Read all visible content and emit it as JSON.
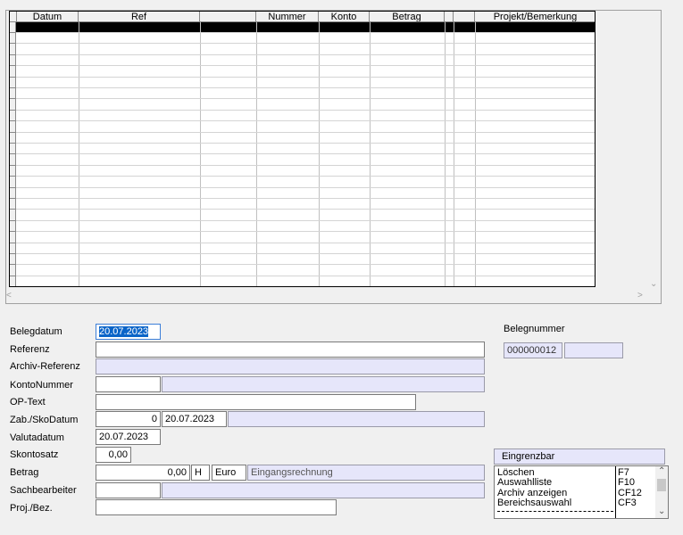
{
  "grid": {
    "columns": [
      "Datum",
      "Ref",
      "",
      "Nummer",
      "Konto",
      "Betrag",
      "",
      "",
      "Projekt/Bemerkung"
    ]
  },
  "form": {
    "belegdatum": {
      "label": "Belegdatum",
      "value": "20.07.2023"
    },
    "referenz": {
      "label": "Referenz",
      "value": ""
    },
    "archiv_referenz": {
      "label": "Archiv-Referenz",
      "value": ""
    },
    "kontonummer": {
      "label": "KontoNummer",
      "value": "",
      "name": ""
    },
    "op_text": {
      "label": "OP-Text",
      "value": ""
    },
    "zab_sko": {
      "label": "Zab./SkoDatum",
      "days": "0",
      "date": "20.07.2023",
      "extra": ""
    },
    "valutadatum": {
      "label": "Valutadatum",
      "value": "20.07.2023"
    },
    "skontosatz": {
      "label": "Skontosatz",
      "value": "0,00"
    },
    "betrag": {
      "label": "Betrag",
      "value": "0,00",
      "side": "H",
      "currency": "Euro",
      "type": "Eingangsrechnung"
    },
    "sachbearbeiter": {
      "label": "Sachbearbeiter",
      "code": "",
      "name": ""
    },
    "proj_bez": {
      "label": "Proj./Bez.",
      "value": ""
    }
  },
  "belegnummer": {
    "label": "Belegnummer",
    "value": "000000012",
    "suffix": ""
  },
  "eingrenzbar": {
    "label": "Eingrenzbar"
  },
  "shortcuts": [
    {
      "label": "Löschen",
      "key": "F7"
    },
    {
      "label": "Auswahlliste",
      "key": "F10"
    },
    {
      "label": "Archiv anzeigen",
      "key": "CF12"
    },
    {
      "label": "Bereichsauswahl",
      "key": "CF3"
    }
  ]
}
